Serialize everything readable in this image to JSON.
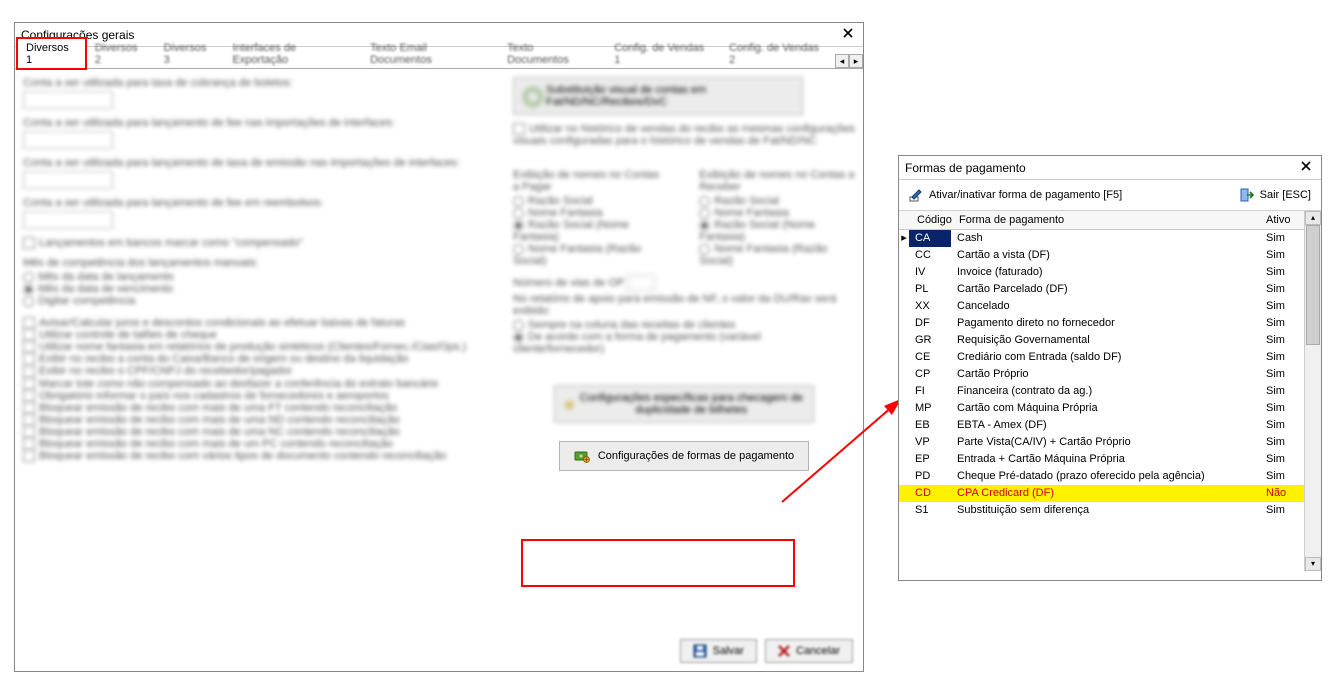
{
  "config_window": {
    "title": "Configurações gerais",
    "tabs": [
      "Diversos 1",
      "Diversos 2",
      "Diversos 3",
      "Interfaces de Exportação",
      "Texto Email Documentos",
      "Texto Documentos",
      "Config. de Vendas 1",
      "Config. de Vendas 2"
    ],
    "active_tab": "Diversos 1",
    "focused_button_label": "Configurações de formas de pagamento",
    "footer": {
      "save": "Salvar",
      "cancel": "Cancelar"
    }
  },
  "formas_window": {
    "title": "Formas de pagamento",
    "toolbar": {
      "activate_label": "Ativar/inativar forma de pagamento [F5]",
      "exit_label": "Sair [ESC]"
    },
    "columns": {
      "code": "Código",
      "desc": "Forma de pagamento",
      "active": "Ativo"
    },
    "rows": [
      {
        "code": "CA",
        "desc": "Cash",
        "active": "Sim",
        "selected": true
      },
      {
        "code": "CC",
        "desc": "Cartão a vista (DF)",
        "active": "Sim"
      },
      {
        "code": "IV",
        "desc": "Invoice (faturado)",
        "active": "Sim"
      },
      {
        "code": "PL",
        "desc": "Cartão Parcelado (DF)",
        "active": "Sim"
      },
      {
        "code": "XX",
        "desc": "Cancelado",
        "active": "Sim"
      },
      {
        "code": "DF",
        "desc": "Pagamento direto no fornecedor",
        "active": "Sim"
      },
      {
        "code": "GR",
        "desc": "Requisição Governamental",
        "active": "Sim"
      },
      {
        "code": "CE",
        "desc": "Crediário com Entrada (saldo DF)",
        "active": "Sim"
      },
      {
        "code": "CP",
        "desc": "Cartão Próprio",
        "active": "Sim"
      },
      {
        "code": "FI",
        "desc": "Financeira (contrato da ag.)",
        "active": "Sim"
      },
      {
        "code": "MP",
        "desc": "Cartão com Máquina Própria",
        "active": "Sim"
      },
      {
        "code": "EB",
        "desc": "EBTA - Amex (DF)",
        "active": "Sim"
      },
      {
        "code": "VP",
        "desc": "Parte Vista(CA/IV) + Cartão Próprio",
        "active": "Sim"
      },
      {
        "code": "EP",
        "desc": "Entrada + Cartão Máquina Própria",
        "active": "Sim"
      },
      {
        "code": "PD",
        "desc": "Cheque Pré-datado (prazo oferecido pela agência)",
        "active": "Sim"
      },
      {
        "code": "CD",
        "desc": "CPA Credicard (DF)",
        "active": "Não",
        "inactive": true
      },
      {
        "code": "S1",
        "desc": "Substituição sem diferença",
        "active": "Sim"
      }
    ]
  }
}
